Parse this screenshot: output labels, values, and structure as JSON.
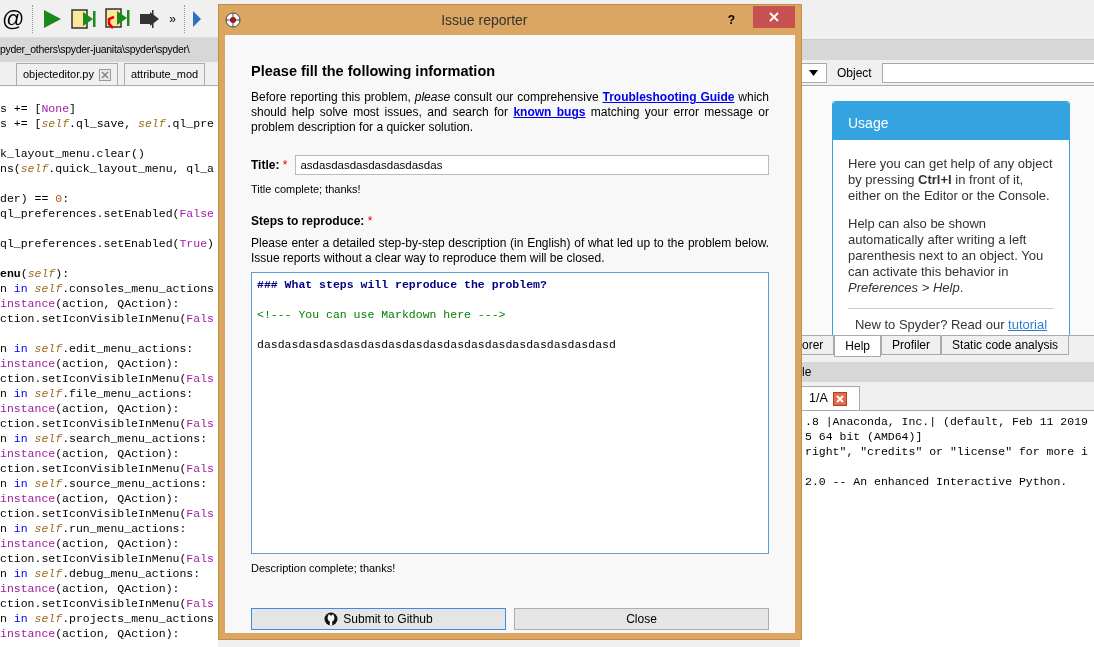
{
  "toolbar": {
    "at_sign": "@",
    "overflow": "»"
  },
  "editor": {
    "path": "pyder_others\\spyder-juanita\\spyder\\spyder\\",
    "tabs": [
      {
        "label": "objecteditor.py",
        "closable": true,
        "selected": false
      },
      {
        "label": "attribute_mod",
        "closable": false,
        "selected": false
      }
    ],
    "lines": [
      {
        "kind": "code",
        "tokens": [
          {
            "kind": "p",
            "text": "s += ["
          },
          {
            "kind": "const",
            "text": "None"
          },
          {
            "kind": "p",
            "text": "]"
          }
        ]
      },
      {
        "kind": "code",
        "tokens": [
          {
            "kind": "p",
            "text": "s += ["
          },
          {
            "kind": "self",
            "text": "self"
          },
          {
            "kind": "p",
            "text": ".ql_save, "
          },
          {
            "kind": "self",
            "text": "self"
          },
          {
            "kind": "p",
            "text": ".ql_pre"
          }
        ]
      },
      {
        "kind": "blank"
      },
      {
        "kind": "code",
        "tokens": [
          {
            "kind": "p",
            "text": "k_layout_menu.clear()"
          }
        ]
      },
      {
        "kind": "code",
        "tokens": [
          {
            "kind": "p",
            "text": "ns("
          },
          {
            "kind": "self",
            "text": "self"
          },
          {
            "kind": "p",
            "text": ".quick_layout_menu, ql_a"
          }
        ]
      },
      {
        "kind": "blank"
      },
      {
        "kind": "code",
        "tokens": [
          {
            "kind": "p",
            "text": "der) == "
          },
          {
            "kind": "num",
            "text": "0"
          },
          {
            "kind": "p",
            "text": ":"
          }
        ]
      },
      {
        "kind": "code",
        "tokens": [
          {
            "kind": "p",
            "text": "ql_preferences.setEnabled("
          },
          {
            "kind": "const",
            "text": "False"
          }
        ]
      },
      {
        "kind": "blank"
      },
      {
        "kind": "code",
        "tokens": [
          {
            "kind": "p",
            "text": "ql_preferences.setEnabled("
          },
          {
            "kind": "const",
            "text": "True"
          },
          {
            "kind": "p",
            "text": ")"
          }
        ]
      },
      {
        "kind": "blank"
      },
      {
        "kind": "code",
        "tokens": [
          {
            "kind": "def",
            "text": "enu"
          },
          {
            "kind": "p",
            "text": "("
          },
          {
            "kind": "self",
            "text": "self"
          },
          {
            "kind": "p",
            "text": "):"
          }
        ]
      },
      {
        "kind": "code",
        "tokens": [
          {
            "kind": "p",
            "text": "n "
          },
          {
            "kind": "kw",
            "text": "in "
          },
          {
            "kind": "self",
            "text": "self"
          },
          {
            "kind": "p",
            "text": ".consoles_menu_actions"
          }
        ]
      },
      {
        "kind": "code",
        "tokens": [
          {
            "kind": "builtin",
            "text": "instance"
          },
          {
            "kind": "p",
            "text": "(action, QAction):"
          }
        ]
      },
      {
        "kind": "code",
        "tokens": [
          {
            "kind": "p",
            "text": "ction.setIconVisibleInMenu("
          },
          {
            "kind": "const",
            "text": "Fals"
          }
        ]
      },
      {
        "kind": "blank"
      },
      {
        "kind": "code",
        "tokens": [
          {
            "kind": "p",
            "text": "n "
          },
          {
            "kind": "kw",
            "text": "in "
          },
          {
            "kind": "self",
            "text": "self"
          },
          {
            "kind": "p",
            "text": ".edit_menu_actions:"
          }
        ]
      },
      {
        "kind": "code",
        "tokens": [
          {
            "kind": "builtin",
            "text": "instance"
          },
          {
            "kind": "p",
            "text": "(action, QAction):"
          }
        ]
      },
      {
        "kind": "code",
        "tokens": [
          {
            "kind": "p",
            "text": "ction.setIconVisibleInMenu("
          },
          {
            "kind": "const",
            "text": "Fals"
          }
        ]
      },
      {
        "kind": "code",
        "tokens": [
          {
            "kind": "p",
            "text": "n "
          },
          {
            "kind": "kw",
            "text": "in "
          },
          {
            "kind": "self",
            "text": "self"
          },
          {
            "kind": "p",
            "text": ".file_menu_actions:"
          }
        ]
      },
      {
        "kind": "code",
        "tokens": [
          {
            "kind": "builtin",
            "text": "instance"
          },
          {
            "kind": "p",
            "text": "(action, QAction):"
          }
        ]
      },
      {
        "kind": "code",
        "tokens": [
          {
            "kind": "p",
            "text": "ction.setIconVisibleInMenu("
          },
          {
            "kind": "const",
            "text": "Fals"
          }
        ]
      },
      {
        "kind": "code",
        "tokens": [
          {
            "kind": "p",
            "text": "n "
          },
          {
            "kind": "kw",
            "text": "in "
          },
          {
            "kind": "self",
            "text": "self"
          },
          {
            "kind": "p",
            "text": ".search_menu_actions:"
          }
        ]
      },
      {
        "kind": "code",
        "tokens": [
          {
            "kind": "builtin",
            "text": "instance"
          },
          {
            "kind": "p",
            "text": "(action, QAction):"
          }
        ]
      },
      {
        "kind": "code",
        "tokens": [
          {
            "kind": "p",
            "text": "ction.setIconVisibleInMenu("
          },
          {
            "kind": "const",
            "text": "Fals"
          }
        ]
      },
      {
        "kind": "code",
        "tokens": [
          {
            "kind": "p",
            "text": "n "
          },
          {
            "kind": "kw",
            "text": "in "
          },
          {
            "kind": "self",
            "text": "self"
          },
          {
            "kind": "p",
            "text": ".source_menu_actions:"
          }
        ]
      },
      {
        "kind": "code",
        "tokens": [
          {
            "kind": "builtin",
            "text": "instance"
          },
          {
            "kind": "p",
            "text": "(action, QAction):"
          }
        ]
      },
      {
        "kind": "code",
        "tokens": [
          {
            "kind": "p",
            "text": "ction.setIconVisibleInMenu("
          },
          {
            "kind": "const",
            "text": "Fals"
          }
        ]
      },
      {
        "kind": "code",
        "tokens": [
          {
            "kind": "p",
            "text": "n "
          },
          {
            "kind": "kw",
            "text": "in "
          },
          {
            "kind": "self",
            "text": "self"
          },
          {
            "kind": "p",
            "text": ".run_menu_actions:"
          }
        ]
      },
      {
        "kind": "code",
        "tokens": [
          {
            "kind": "builtin",
            "text": "instance"
          },
          {
            "kind": "p",
            "text": "(action, QAction):"
          }
        ]
      },
      {
        "kind": "code",
        "tokens": [
          {
            "kind": "p",
            "text": "ction.setIconVisibleInMenu("
          },
          {
            "kind": "const",
            "text": "Fals"
          }
        ]
      },
      {
        "kind": "code",
        "tokens": [
          {
            "kind": "p",
            "text": "n "
          },
          {
            "kind": "kw",
            "text": "in "
          },
          {
            "kind": "self",
            "text": "self"
          },
          {
            "kind": "p",
            "text": ".debug_menu_actions:"
          }
        ]
      },
      {
        "kind": "code",
        "tokens": [
          {
            "kind": "builtin",
            "text": "instance"
          },
          {
            "kind": "p",
            "text": "(action, QAction):"
          }
        ]
      },
      {
        "kind": "code",
        "tokens": [
          {
            "kind": "p",
            "text": "ction.setIconVisibleInMenu("
          },
          {
            "kind": "const",
            "text": "Fals"
          }
        ]
      },
      {
        "kind": "code",
        "tokens": [
          {
            "kind": "p",
            "text": "n "
          },
          {
            "kind": "kw",
            "text": "in "
          },
          {
            "kind": "self",
            "text": "self"
          },
          {
            "kind": "p",
            "text": ".projects_menu_actions"
          }
        ]
      },
      {
        "kind": "code",
        "tokens": [
          {
            "kind": "builtin",
            "text": "instance"
          },
          {
            "kind": "p",
            "text": "(action, QAction):"
          }
        ]
      }
    ]
  },
  "help_pane": {
    "object_label": "Object",
    "usage": {
      "title": "Usage",
      "paragraphs": [
        "Here you can get help of any object by pressing **Ctrl+I** in front of it, either on the Editor or the Console.",
        "Help can also be shown automatically after writing a left parenthesis next to an object. You can activate this behavior in *Preferences > Help*."
      ],
      "footer": {
        "text": "New to Spyder? Read our ",
        "link": "tutorial"
      }
    },
    "tabs": [
      {
        "label": "orer",
        "selected": false
      },
      {
        "label": "Help",
        "selected": true
      },
      {
        "label": "Profiler",
        "selected": false
      },
      {
        "label": "Static code analysis",
        "selected": false
      }
    ]
  },
  "console": {
    "title": "le",
    "tabs": [
      {
        "label": "1/A",
        "closable": true,
        "selected": true
      }
    ],
    "lines": [
      {
        "kind": "text",
        "text": ".8 |Anaconda, Inc.| (default, Feb 11 2019"
      },
      {
        "kind": "text",
        "text": "5 64 bit (AMD64)]"
      },
      {
        "kind": "text",
        "text": "right\", \"credits\" or \"license\" for more i"
      },
      {
        "kind": "blank"
      },
      {
        "kind": "text",
        "text": "2.0 -- An enhanced Interactive Python."
      }
    ]
  },
  "dialog": {
    "title": "Issue reporter",
    "help": "?",
    "heading": "Please fill the following information",
    "intro": [
      {
        "kind": "text",
        "text": "Before reporting this problem, *please* consult our comprehensive "
      },
      {
        "kind": "link",
        "text": "Troubleshooting Guide"
      },
      {
        "kind": "text",
        "text": " which should help solve most issues, and search for "
      },
      {
        "kind": "link",
        "text": "known bugs"
      },
      {
        "kind": "text",
        "text": " matching your error message or problem description for a quicker solution."
      }
    ],
    "title_field": {
      "label": "Title:",
      "required": "*",
      "value": "asdasdasdasdasdasdasdas"
    },
    "title_status": "Title complete; thanks!",
    "steps": {
      "label": "Steps to reproduce:",
      "required": "*",
      "help": "Please enter a detailed step-by-step description (in English) of what led up to the problem below. Issue reports without a clear way to reproduce them will be closed.",
      "lines": [
        {
          "kind": "heading",
          "text": "### What steps will reproduce the problem?"
        },
        {
          "kind": "blank"
        },
        {
          "kind": "comment",
          "text": "<!--- You can use Markdown here --->"
        },
        {
          "kind": "blank"
        },
        {
          "kind": "plain",
          "text": "dasdasdasdasdasdasdasdasdasdasdasdasdasdasdasdasdasd"
        }
      ]
    },
    "steps_status": "Description complete; thanks!",
    "buttons": [
      {
        "label": "Submit to Github",
        "kind": "submit",
        "focused": true
      },
      {
        "label": "Close",
        "kind": "plain",
        "focused": false
      }
    ]
  }
}
